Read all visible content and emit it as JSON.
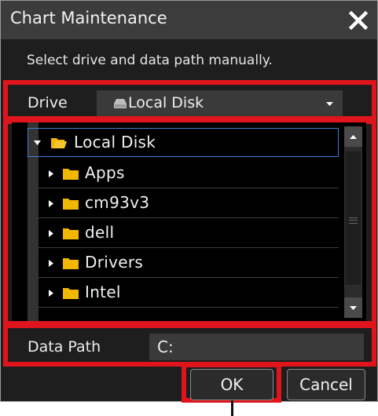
{
  "dialog": {
    "title": "Chart Maintenance",
    "close_icon": "close-icon",
    "instruction": "Select drive and data path manually."
  },
  "drive": {
    "label": "Drive",
    "selected": "Local Disk",
    "icon": "disk-icon"
  },
  "tree": {
    "root": {
      "label": "Local Disk",
      "expanded": true
    },
    "items": [
      {
        "label": "Apps"
      },
      {
        "label": "cm93v3"
      },
      {
        "label": "dell"
      },
      {
        "label": "Drivers"
      },
      {
        "label": "Intel"
      }
    ]
  },
  "data_path": {
    "label": "Data Path",
    "value": "C:"
  },
  "buttons": {
    "ok": "OK",
    "cancel": "Cancel"
  },
  "colors": {
    "highlight_frame": "#e0141c",
    "folder": "#f2b701",
    "selection_border": "#3c7fd0",
    "background": "#1e1e1e"
  }
}
